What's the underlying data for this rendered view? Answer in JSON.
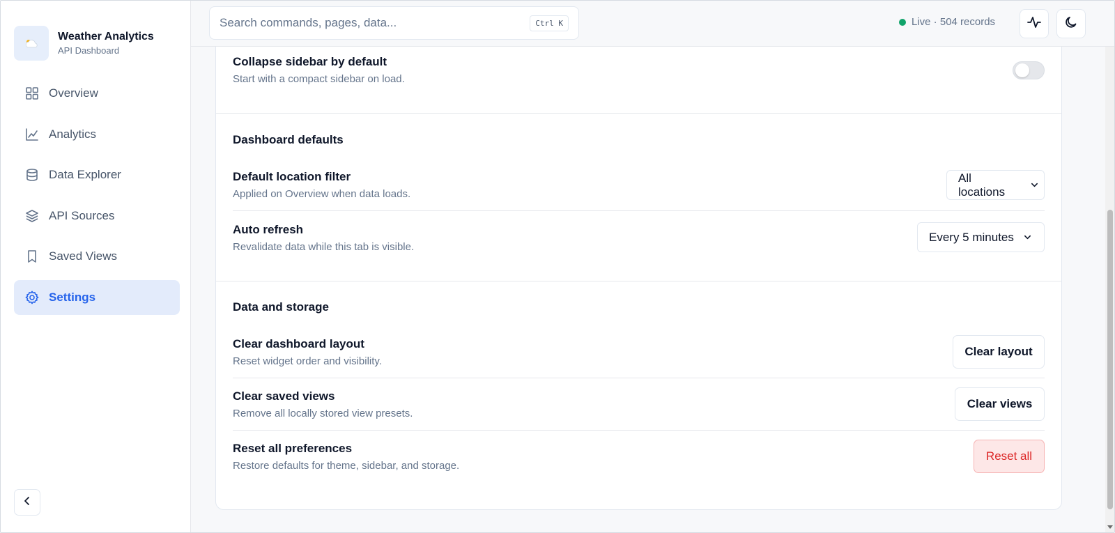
{
  "brand": {
    "title": "Weather Analytics",
    "subtitle": "API Dashboard",
    "logo_icon": "cloud-sun-icon"
  },
  "sidebar": {
    "items": [
      {
        "label": "Overview",
        "icon": "grid-icon",
        "active": false
      },
      {
        "label": "Analytics",
        "icon": "line-chart-icon",
        "active": false
      },
      {
        "label": "Data Explorer",
        "icon": "database-icon",
        "active": false
      },
      {
        "label": "API Sources",
        "icon": "layers-icon",
        "active": false
      },
      {
        "label": "Saved Views",
        "icon": "bookmark-icon",
        "active": false
      },
      {
        "label": "Settings",
        "icon": "gear-icon",
        "active": true
      }
    ],
    "collapse_icon": "chevron-left-icon"
  },
  "topbar": {
    "search_placeholder": "Search commands, pages, data...",
    "shortcut": "Ctrl K",
    "status_text": "Live · 504 records",
    "status_color": "#10a36a"
  },
  "settings": {
    "collapse_sidebar": {
      "title": "Collapse sidebar by default",
      "desc": "Start with a compact sidebar on load.",
      "enabled": false
    },
    "dashboard_defaults": {
      "title": "Dashboard defaults",
      "location_filter": {
        "title": "Default location filter",
        "desc": "Applied on Overview when data loads.",
        "value": "All locations"
      },
      "auto_refresh": {
        "title": "Auto refresh",
        "desc": "Revalidate data while this tab is visible.",
        "value": "Every 5 minutes"
      }
    },
    "data_storage": {
      "title": "Data and storage",
      "clear_layout": {
        "title": "Clear dashboard layout",
        "desc": "Reset widget order and visibility.",
        "button": "Clear layout"
      },
      "clear_views": {
        "title": "Clear saved views",
        "desc": "Remove all locally stored view presets.",
        "button": "Clear views"
      },
      "reset_all": {
        "title": "Reset all preferences",
        "desc": "Restore defaults for theme, sidebar, and storage.",
        "button": "Reset all"
      }
    }
  },
  "colors": {
    "accent": "#2563eb",
    "active_bg": "#e3ebfb",
    "danger": "#dc2626",
    "danger_bg": "#fde7e7"
  }
}
